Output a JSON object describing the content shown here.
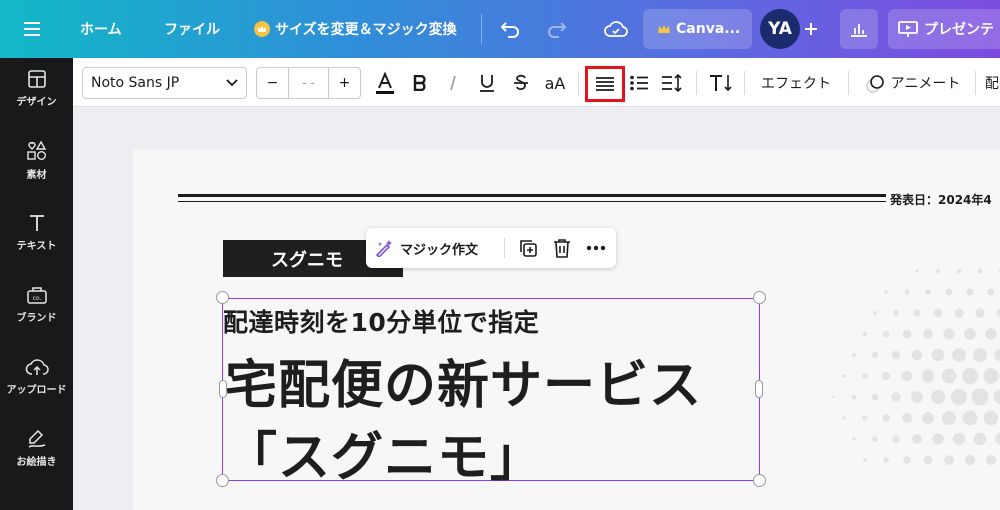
{
  "topbar": {
    "menu_icon": "hamburger-icon",
    "home": "ホーム",
    "file": "ファイル",
    "resize": "サイズを変更＆マジック変換",
    "canva_pill": "Canva...",
    "avatar_initials": "YA",
    "present": "プレゼンテ"
  },
  "sidebar": {
    "items": [
      {
        "label": "デザイン",
        "icon": "design-icon"
      },
      {
        "label": "素材",
        "icon": "elements-icon"
      },
      {
        "label": "テキスト",
        "icon": "text-icon"
      },
      {
        "label": "ブランド",
        "icon": "brand-icon"
      },
      {
        "label": "アップロード",
        "icon": "upload-icon"
      },
      {
        "label": "お絵描き",
        "icon": "draw-icon"
      }
    ]
  },
  "toolbar": {
    "font_family": "Noto Sans JP",
    "font_size": "- -",
    "minus": "−",
    "plus": "+",
    "case_label": "aA",
    "effects": "エフェクト",
    "animate": "アニメート",
    "trailing": "配"
  },
  "float_bar": {
    "magic_write": "マジック作文"
  },
  "document": {
    "date": "発表日：2024年4",
    "tag": "スグニモ",
    "subtitle": "配達時刻を10分単位で指定",
    "title_line1": "宅配便の新サービス",
    "title_line2": "「スグニモ」"
  },
  "colors": {
    "highlight_box": "#e5141c",
    "selection": "#8b3dff",
    "sidebar_bg": "#18191b"
  }
}
